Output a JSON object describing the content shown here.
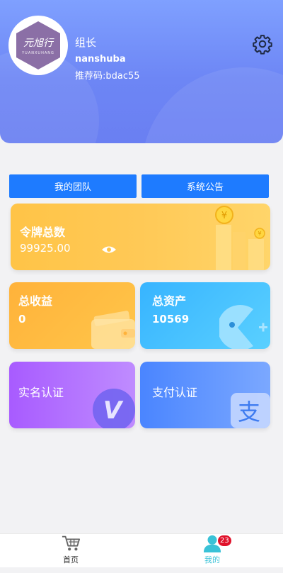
{
  "profile": {
    "avatar_text": "元旭行",
    "avatar_subtext": "YUANXUHANG",
    "role": "组长",
    "username": "nanshuba",
    "ref_label": "推荐码:",
    "ref_code": "bdac55"
  },
  "actions": {
    "team_label": "我的团队",
    "notice_label": "系统公告"
  },
  "cards": {
    "token": {
      "title": "令牌总数",
      "value": "99925.00"
    },
    "income": {
      "title": "总收益",
      "value": "0"
    },
    "assets": {
      "title": "总资产",
      "value": "10569"
    },
    "realname": {
      "title": "实名认证",
      "icon_glyph": "V"
    },
    "pay": {
      "title": "支付认证",
      "icon_glyph": "支"
    }
  },
  "tabbar": {
    "home_label": "首页",
    "mine_label": "我的",
    "mine_badge": "23"
  },
  "colors": {
    "header": "#6d86f5",
    "button": "#1e7bff",
    "token_card": "#ffc447",
    "income_card": "#ffb23a",
    "assets_card": "#37b4ff",
    "realname_card": "#a85bff",
    "pay_card": "#4a85ff",
    "active_tab": "#39c2d7",
    "badge": "#e0112a"
  },
  "icons": [
    "gear-icon",
    "eye-icon",
    "coin-stack-icon",
    "wallet-icon",
    "pacman-icon",
    "v-icon",
    "alipay-icon",
    "cart-icon",
    "user-icon"
  ]
}
